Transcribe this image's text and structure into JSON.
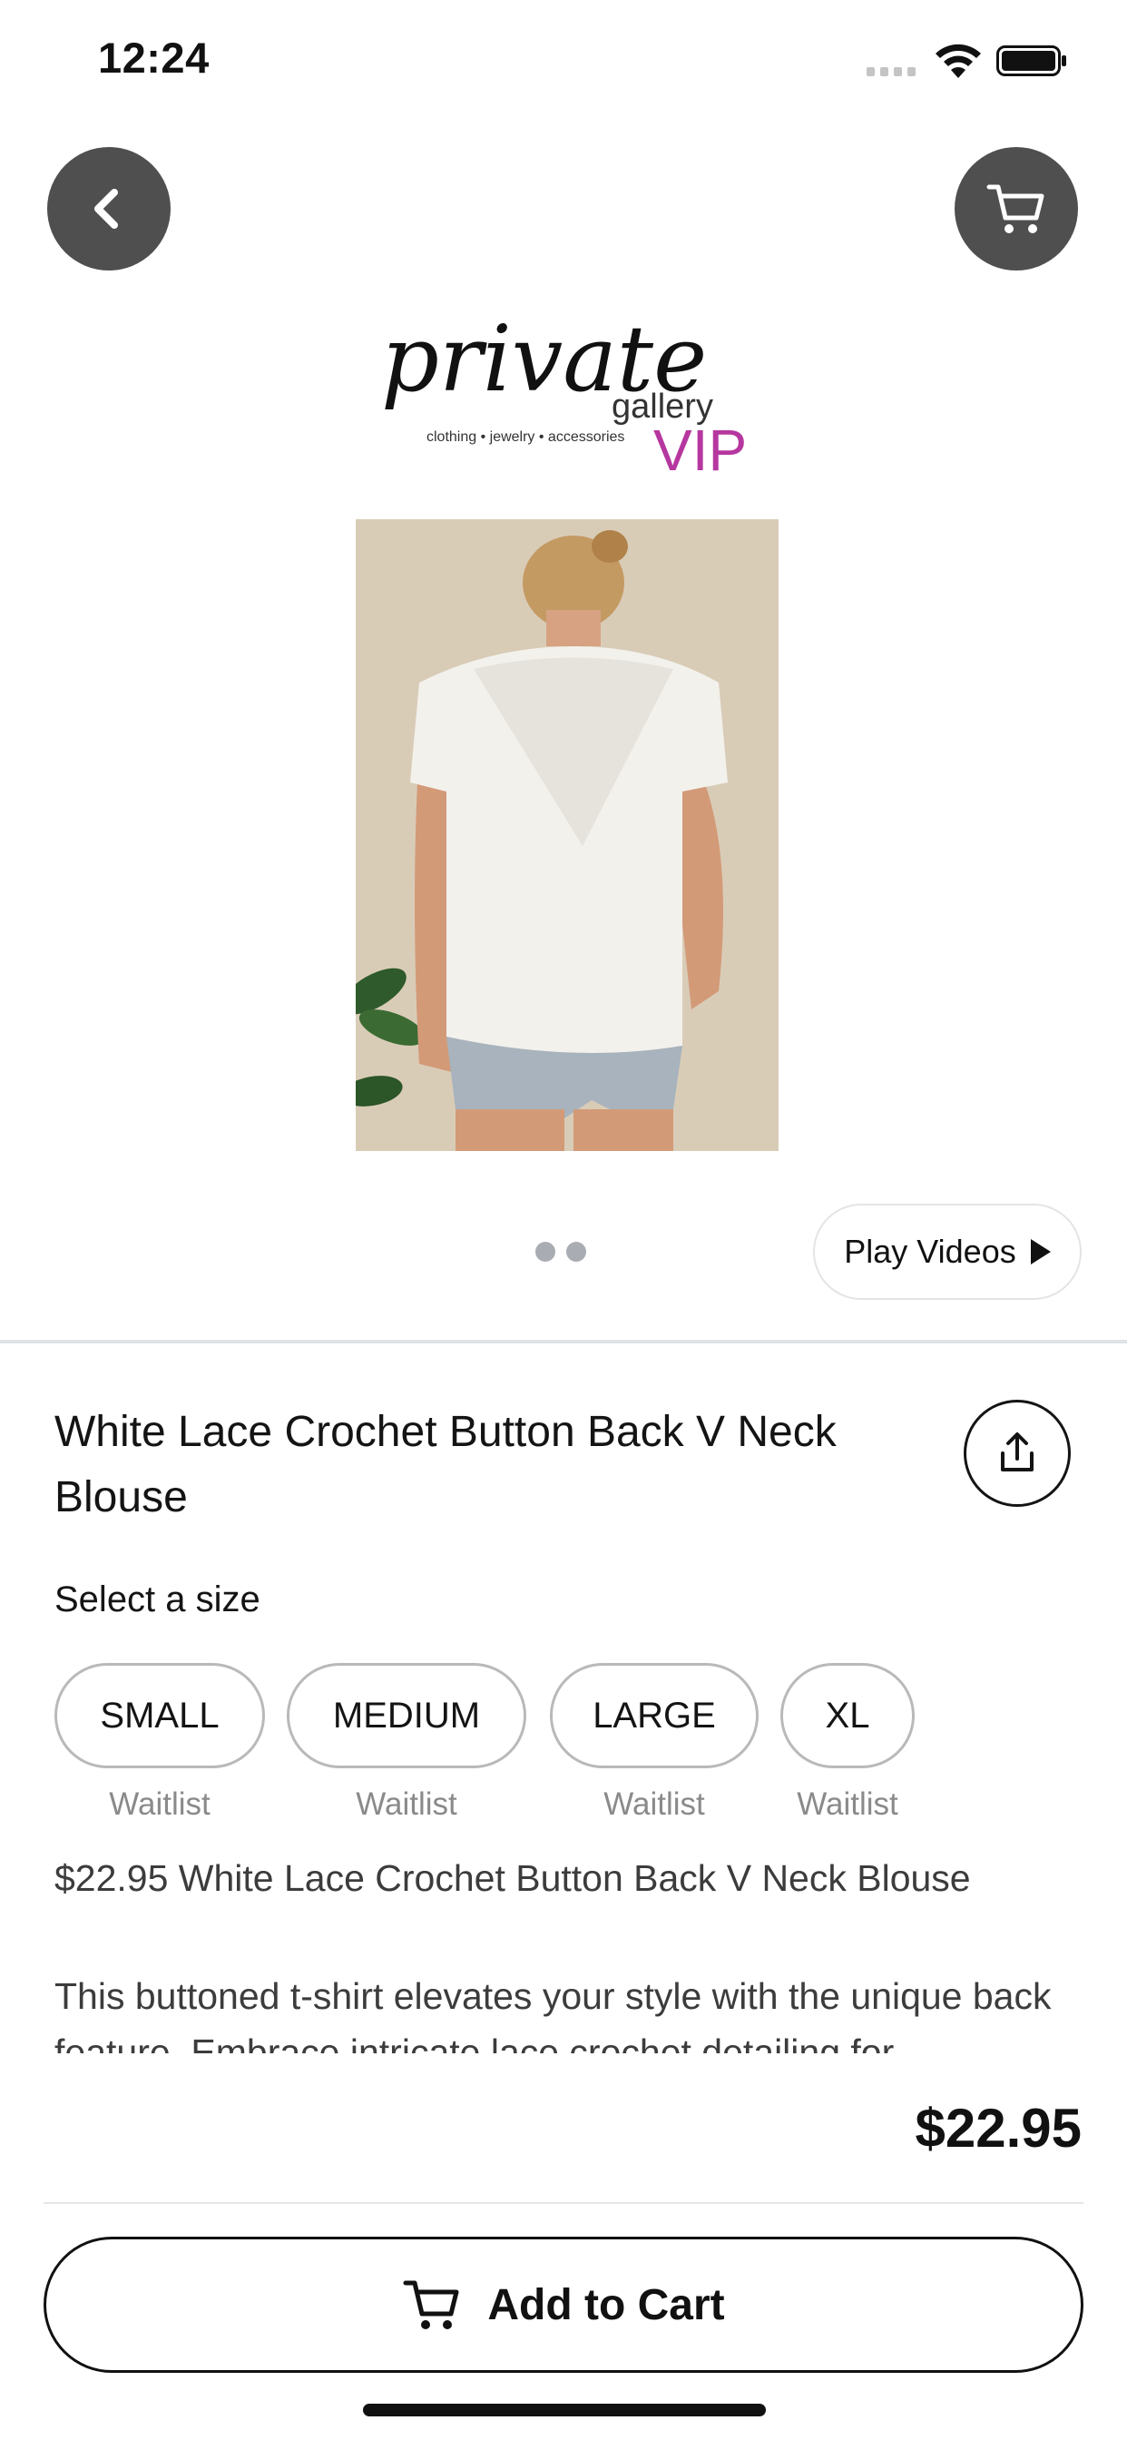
{
  "status_bar": {
    "time": "12:24"
  },
  "header": {
    "back_icon": "chevron-left-icon",
    "cart_icon": "cart-icon"
  },
  "brand": {
    "name": "private",
    "sub": "gallery",
    "tagline": "clothing • jewelry • accessories",
    "vip": "VIP",
    "vip_color": "#b6379f"
  },
  "carousel": {
    "page_count": 2,
    "current_page": 1
  },
  "play_videos_label": "Play Videos",
  "product": {
    "title": "White Lace Crochet Button Back V Neck Blouse",
    "select_size_label": "Select a size",
    "sizes": [
      {
        "label": "SMALL",
        "status": "Waitlist"
      },
      {
        "label": "MEDIUM",
        "status": "Waitlist"
      },
      {
        "label": "LARGE",
        "status": "Waitlist"
      },
      {
        "label": "XL",
        "status": "Waitlist"
      }
    ],
    "price_line": "$22.95 White Lace Crochet Button Back V Neck Blouse",
    "description": "This buttoned t-shirt elevates your style with the unique back feature. Embrace intricate lace crochet detailing for"
  },
  "footer": {
    "price": "$22.95",
    "add_to_cart_label": "Add to Cart"
  }
}
